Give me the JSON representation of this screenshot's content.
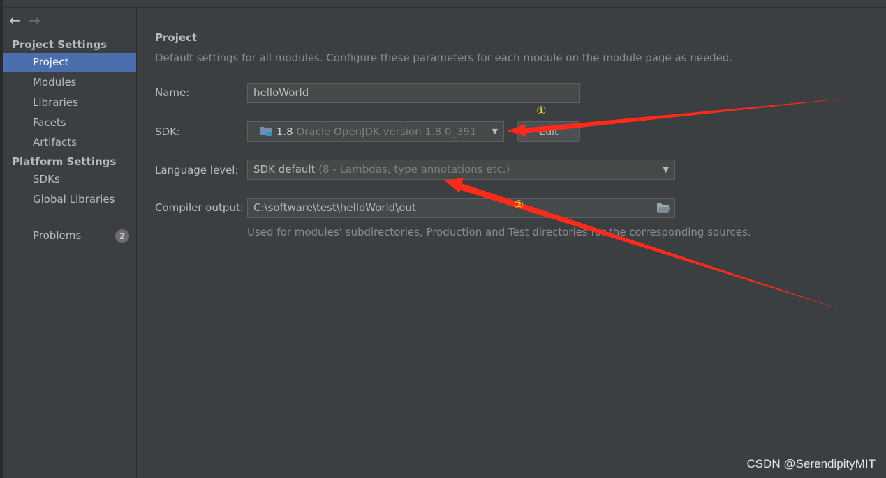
{
  "sidebar": {
    "section_project_settings": "Project Settings",
    "section_platform_settings": "Platform Settings",
    "items_project": [
      {
        "label": "Project"
      },
      {
        "label": "Modules"
      },
      {
        "label": "Libraries"
      },
      {
        "label": "Facets"
      },
      {
        "label": "Artifacts"
      }
    ],
    "items_platform": [
      {
        "label": "SDKs"
      },
      {
        "label": "Global Libraries"
      }
    ],
    "problems": {
      "label": "Problems",
      "count": "2"
    }
  },
  "main": {
    "title": "Project",
    "description": "Default settings for all modules. Configure these parameters for each module on the module page as needed.",
    "name": {
      "label": "Name:",
      "value": "helloWorld"
    },
    "sdk": {
      "label": "SDK:",
      "version": "1.8",
      "detail": "Oracle OpenJDK version 1.8.0_391",
      "edit_label": "Edit"
    },
    "language_level": {
      "label": "Language level:",
      "value": "SDK default",
      "detail": "(8 - Lambdas, type annotations etc.)"
    },
    "compiler_output": {
      "label": "Compiler output:",
      "value": "C:\\software\\test\\helloWorld\\out"
    },
    "compiler_hint": "Used for modules' subdirectories, Production and Test directories for the corresponding sources."
  },
  "annotations": {
    "one": "①",
    "two": "②"
  },
  "watermark": "CSDN @SerendipityMIT",
  "colors": {
    "selection": "#4b6eaf",
    "annotation_arrow": "#ff2a1a",
    "annotation_number": "#f0e020"
  }
}
